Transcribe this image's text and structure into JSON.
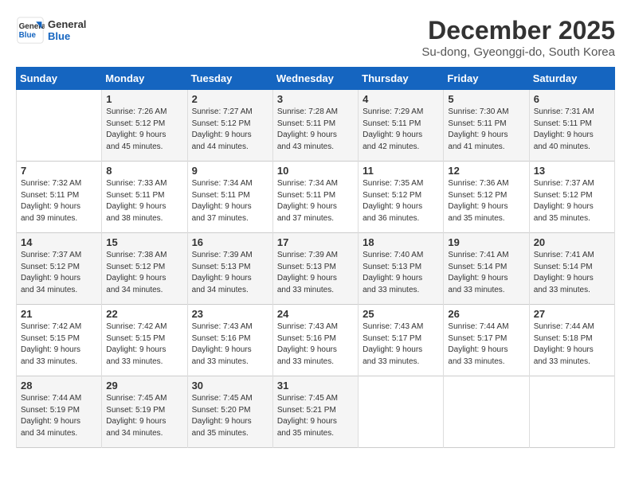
{
  "logo": {
    "line1": "General",
    "line2": "Blue"
  },
  "title": "December 2025",
  "subtitle": "Su-dong, Gyeonggi-do, South Korea",
  "weekdays": [
    "Sunday",
    "Monday",
    "Tuesday",
    "Wednesday",
    "Thursday",
    "Friday",
    "Saturday"
  ],
  "weeks": [
    [
      {
        "day": "",
        "info": ""
      },
      {
        "day": "1",
        "info": "Sunrise: 7:26 AM\nSunset: 5:12 PM\nDaylight: 9 hours\nand 45 minutes."
      },
      {
        "day": "2",
        "info": "Sunrise: 7:27 AM\nSunset: 5:12 PM\nDaylight: 9 hours\nand 44 minutes."
      },
      {
        "day": "3",
        "info": "Sunrise: 7:28 AM\nSunset: 5:11 PM\nDaylight: 9 hours\nand 43 minutes."
      },
      {
        "day": "4",
        "info": "Sunrise: 7:29 AM\nSunset: 5:11 PM\nDaylight: 9 hours\nand 42 minutes."
      },
      {
        "day": "5",
        "info": "Sunrise: 7:30 AM\nSunset: 5:11 PM\nDaylight: 9 hours\nand 41 minutes."
      },
      {
        "day": "6",
        "info": "Sunrise: 7:31 AM\nSunset: 5:11 PM\nDaylight: 9 hours\nand 40 minutes."
      }
    ],
    [
      {
        "day": "7",
        "info": "Sunrise: 7:32 AM\nSunset: 5:11 PM\nDaylight: 9 hours\nand 39 minutes."
      },
      {
        "day": "8",
        "info": "Sunrise: 7:33 AM\nSunset: 5:11 PM\nDaylight: 9 hours\nand 38 minutes."
      },
      {
        "day": "9",
        "info": "Sunrise: 7:34 AM\nSunset: 5:11 PM\nDaylight: 9 hours\nand 37 minutes."
      },
      {
        "day": "10",
        "info": "Sunrise: 7:34 AM\nSunset: 5:11 PM\nDaylight: 9 hours\nand 37 minutes."
      },
      {
        "day": "11",
        "info": "Sunrise: 7:35 AM\nSunset: 5:12 PM\nDaylight: 9 hours\nand 36 minutes."
      },
      {
        "day": "12",
        "info": "Sunrise: 7:36 AM\nSunset: 5:12 PM\nDaylight: 9 hours\nand 35 minutes."
      },
      {
        "day": "13",
        "info": "Sunrise: 7:37 AM\nSunset: 5:12 PM\nDaylight: 9 hours\nand 35 minutes."
      }
    ],
    [
      {
        "day": "14",
        "info": "Sunrise: 7:37 AM\nSunset: 5:12 PM\nDaylight: 9 hours\nand 34 minutes."
      },
      {
        "day": "15",
        "info": "Sunrise: 7:38 AM\nSunset: 5:12 PM\nDaylight: 9 hours\nand 34 minutes."
      },
      {
        "day": "16",
        "info": "Sunrise: 7:39 AM\nSunset: 5:13 PM\nDaylight: 9 hours\nand 34 minutes."
      },
      {
        "day": "17",
        "info": "Sunrise: 7:39 AM\nSunset: 5:13 PM\nDaylight: 9 hours\nand 33 minutes."
      },
      {
        "day": "18",
        "info": "Sunrise: 7:40 AM\nSunset: 5:13 PM\nDaylight: 9 hours\nand 33 minutes."
      },
      {
        "day": "19",
        "info": "Sunrise: 7:41 AM\nSunset: 5:14 PM\nDaylight: 9 hours\nand 33 minutes."
      },
      {
        "day": "20",
        "info": "Sunrise: 7:41 AM\nSunset: 5:14 PM\nDaylight: 9 hours\nand 33 minutes."
      }
    ],
    [
      {
        "day": "21",
        "info": "Sunrise: 7:42 AM\nSunset: 5:15 PM\nDaylight: 9 hours\nand 33 minutes."
      },
      {
        "day": "22",
        "info": "Sunrise: 7:42 AM\nSunset: 5:15 PM\nDaylight: 9 hours\nand 33 minutes."
      },
      {
        "day": "23",
        "info": "Sunrise: 7:43 AM\nSunset: 5:16 PM\nDaylight: 9 hours\nand 33 minutes."
      },
      {
        "day": "24",
        "info": "Sunrise: 7:43 AM\nSunset: 5:16 PM\nDaylight: 9 hours\nand 33 minutes."
      },
      {
        "day": "25",
        "info": "Sunrise: 7:43 AM\nSunset: 5:17 PM\nDaylight: 9 hours\nand 33 minutes."
      },
      {
        "day": "26",
        "info": "Sunrise: 7:44 AM\nSunset: 5:17 PM\nDaylight: 9 hours\nand 33 minutes."
      },
      {
        "day": "27",
        "info": "Sunrise: 7:44 AM\nSunset: 5:18 PM\nDaylight: 9 hours\nand 33 minutes."
      }
    ],
    [
      {
        "day": "28",
        "info": "Sunrise: 7:44 AM\nSunset: 5:19 PM\nDaylight: 9 hours\nand 34 minutes."
      },
      {
        "day": "29",
        "info": "Sunrise: 7:45 AM\nSunset: 5:19 PM\nDaylight: 9 hours\nand 34 minutes."
      },
      {
        "day": "30",
        "info": "Sunrise: 7:45 AM\nSunset: 5:20 PM\nDaylight: 9 hours\nand 35 minutes."
      },
      {
        "day": "31",
        "info": "Sunrise: 7:45 AM\nSunset: 5:21 PM\nDaylight: 9 hours\nand 35 minutes."
      },
      {
        "day": "",
        "info": ""
      },
      {
        "day": "",
        "info": ""
      },
      {
        "day": "",
        "info": ""
      }
    ]
  ]
}
